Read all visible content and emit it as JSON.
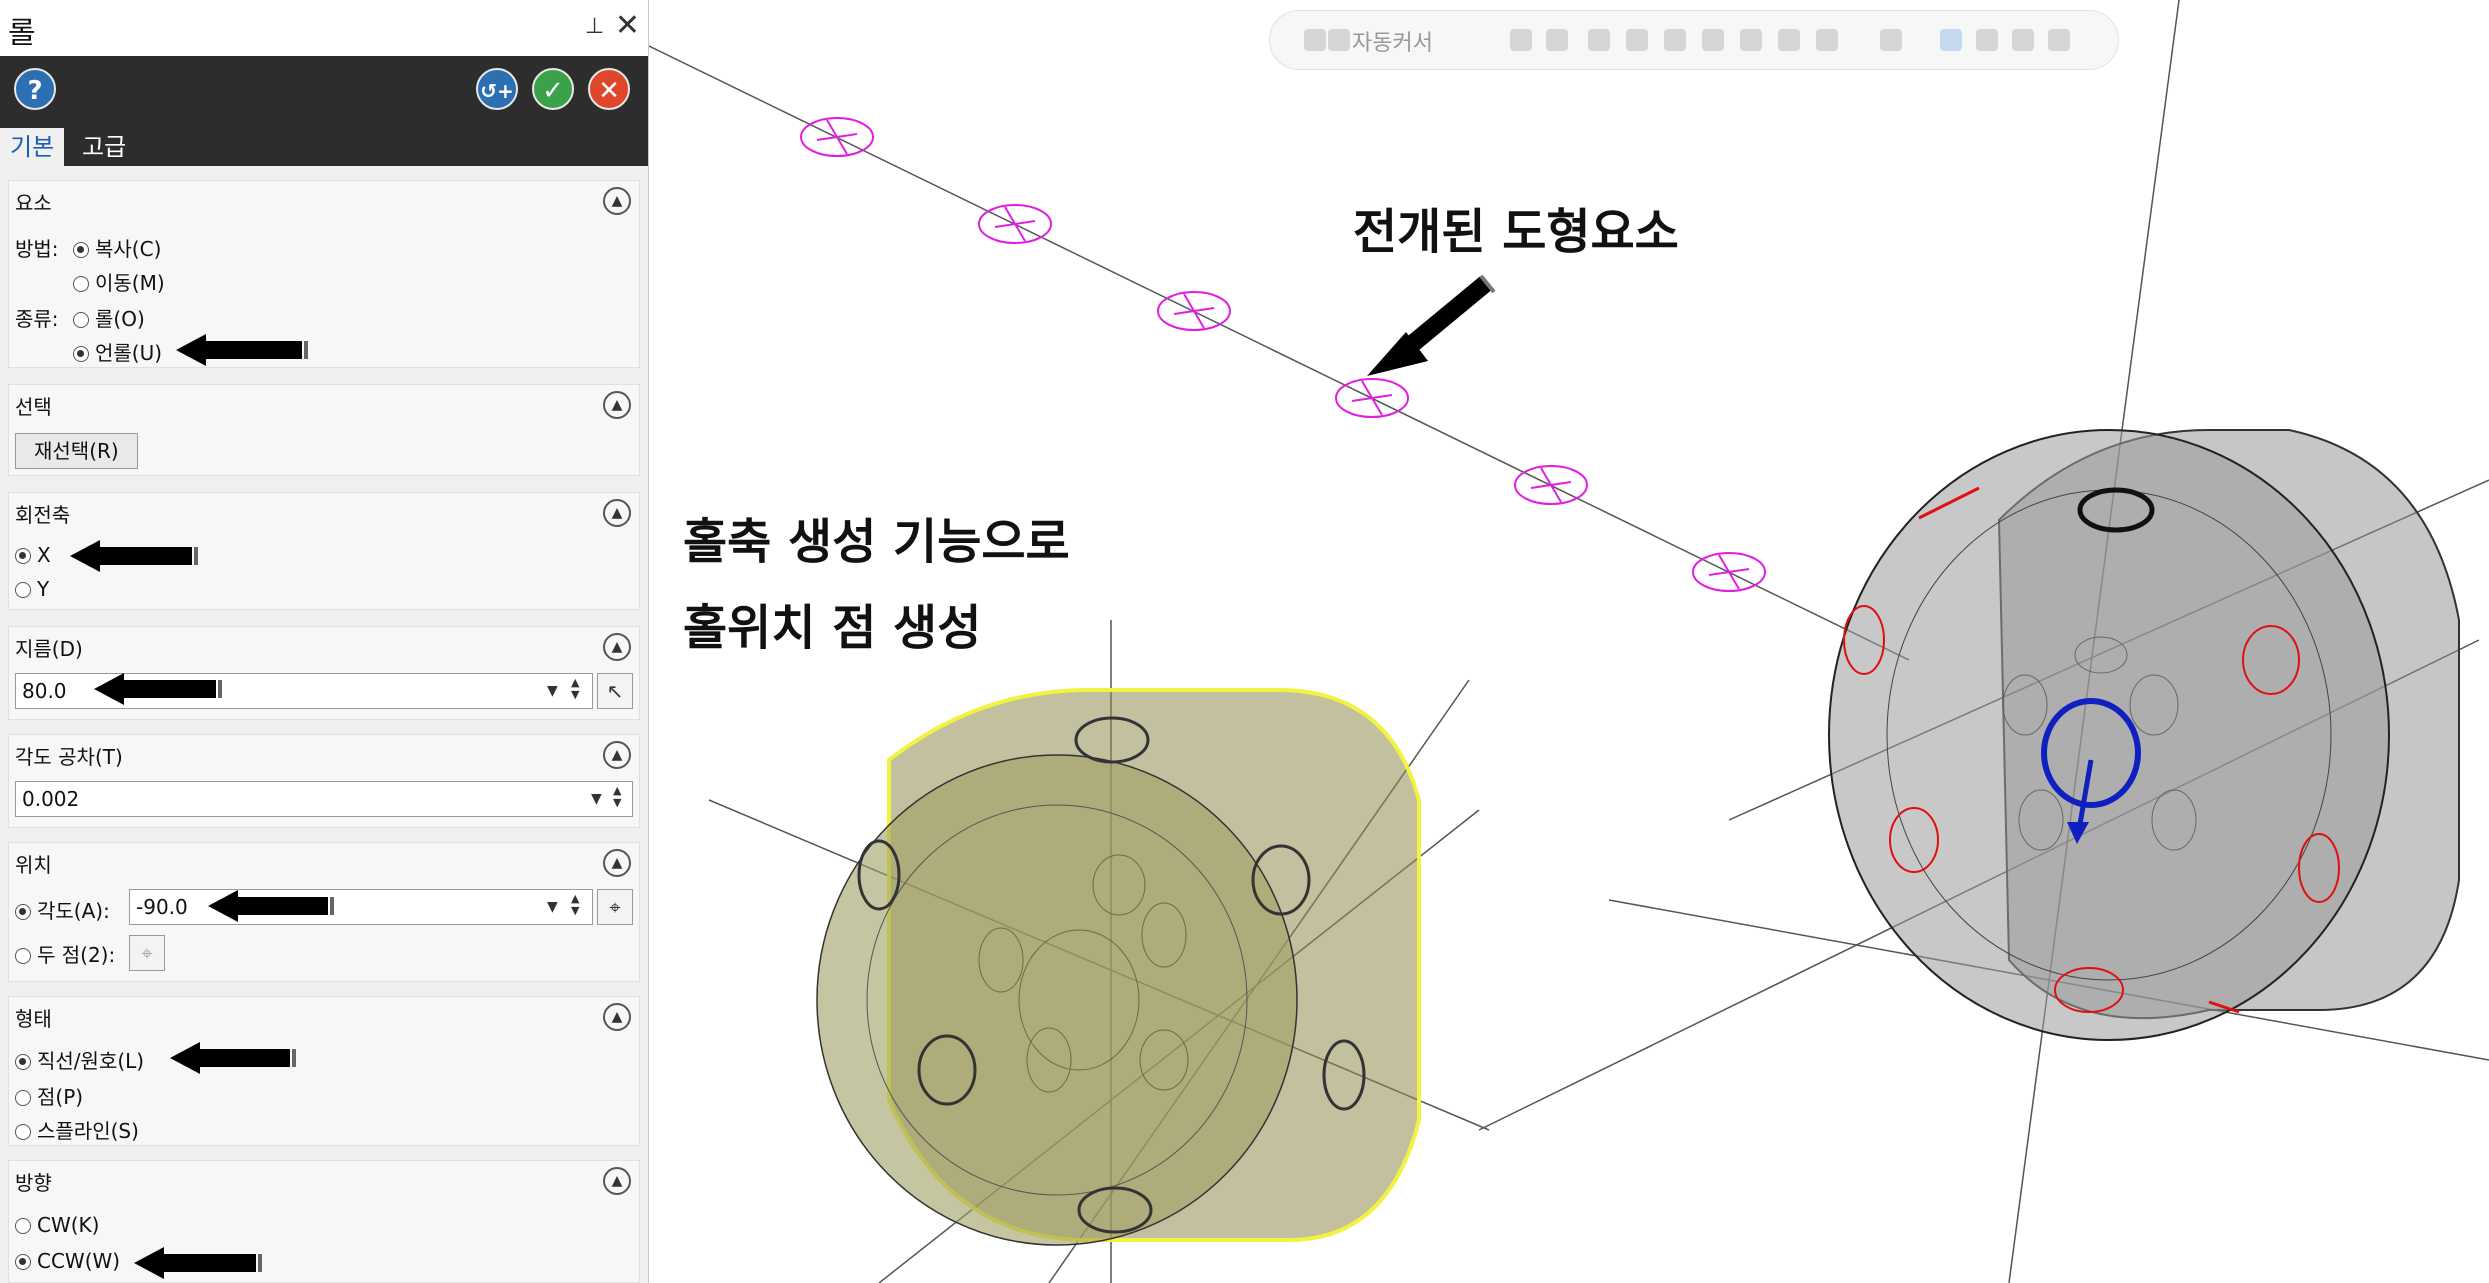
{
  "panel": {
    "title": "롤",
    "pin_icon": "pin-icon",
    "close_icon": "close-icon",
    "help_label": "?",
    "apply_label": "↺+",
    "ok_label": "✓",
    "cancel_label": "✕",
    "tabs": [
      "기본",
      "고급"
    ],
    "sections": {
      "element": {
        "title": "요소",
        "method_label": "방법:",
        "method_options": [
          "복사(C)",
          "이동(M)"
        ],
        "type_label": "종류:",
        "type_options": [
          "롤(O)",
          "언롤(U)"
        ]
      },
      "select": {
        "title": "선택",
        "reselect_label": "재선택(R)"
      },
      "axis": {
        "title": "회전축",
        "options": [
          "X",
          "Y"
        ]
      },
      "diameter": {
        "title": "지름(D)",
        "value": "80.0"
      },
      "tolerance": {
        "title": "각도 공차(T)",
        "value": "0.002"
      },
      "position": {
        "title": "위치",
        "angle_label": "각도(A):",
        "angle_value": "-90.0",
        "two_points_label": "두 점(2):"
      },
      "shape": {
        "title": "형태",
        "options": [
          "직선/원호(L)",
          "점(P)",
          "스플라인(S)"
        ]
      },
      "direction": {
        "title": "방향",
        "options": [
          "CW(K)",
          "CCW(W)"
        ]
      }
    }
  },
  "viewport": {
    "toolbar_label": "자동커서",
    "annotation_unrolled": "전개된 도형요소",
    "annotation_holes_line1": "홀축 생성 기능으로",
    "annotation_holes_line2": "홀위치 점 생성"
  },
  "colors": {
    "panel_dark": "#2d2d2d",
    "tab_active_text": "#1a5fb4",
    "unroll_points": "#e020e0",
    "olive_body": "#8f8d4f",
    "gray_body": "#8e8e8e",
    "hole_mark_red": "#e01010",
    "axis_blue": "#1020c0"
  }
}
